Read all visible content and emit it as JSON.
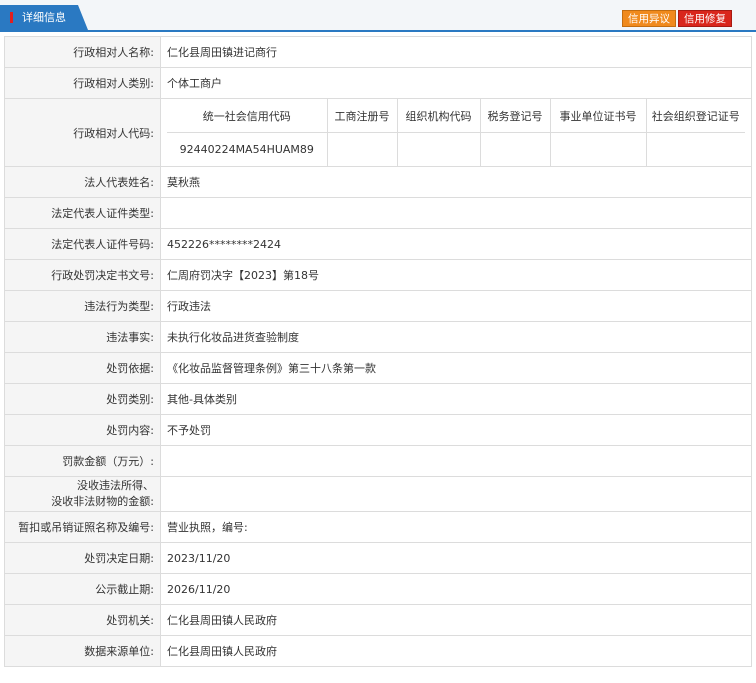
{
  "header": {
    "tab_label": "详细信息",
    "objection_button": "信用异议",
    "repair_button": "信用修复"
  },
  "fields": {
    "name": {
      "label": "行政相对人名称:",
      "value": "仁化县周田镇进记商行"
    },
    "category": {
      "label": "行政相对人类别:",
      "value": "个体工商户"
    },
    "codes_label": "行政相对人代码:",
    "legal_rep": {
      "label": "法人代表姓名:",
      "value": "莫秋燕"
    },
    "cert_type": {
      "label": "法定代表人证件类型:",
      "value": ""
    },
    "cert_no": {
      "label": "法定代表人证件号码:",
      "value": "452226********2424"
    },
    "doc_no": {
      "label": "行政处罚决定书文号:",
      "value": "仁周府罚决字【2023】第18号"
    },
    "violation_type": {
      "label": "违法行为类型:",
      "value": "行政违法"
    },
    "violation_fact": {
      "label": "违法事实:",
      "value": "未执行化妆品进货查验制度"
    },
    "basis": {
      "label": "处罚依据:",
      "value": "《化妆品监督管理条例》第三十八条第一款"
    },
    "penalty_category": {
      "label": "处罚类别:",
      "value": "其他-具体类别"
    },
    "penalty_content": {
      "label": "处罚内容:",
      "value": "不予处罚"
    },
    "fine": {
      "label": "罚款金额（万元）:",
      "value": ""
    },
    "confiscation": {
      "label_line1": "没收违法所得、",
      "label_line2": "没收非法财物的金额:",
      "value": ""
    },
    "license": {
      "label": "暂扣或吊销证照名称及编号:",
      "value": "营业执照，编号:"
    },
    "decision_date": {
      "label": "处罚决定日期:",
      "value": "2023/11/20"
    },
    "publicity_end": {
      "label": "公示截止期:",
      "value": "2026/11/20"
    },
    "authority": {
      "label": "处罚机关:",
      "value": "仁化县周田镇人民政府"
    },
    "source_unit": {
      "label": "数据来源单位:",
      "value": "仁化县周田镇人民政府"
    }
  },
  "codes": {
    "headers": [
      "统一社会信用代码",
      "工商注册号",
      "组织机构代码",
      "税务登记号",
      "事业单位证书号",
      "社会组织登记证号"
    ],
    "values": [
      "92440224MA54HUAM89",
      "",
      "",
      "",
      "",
      ""
    ]
  }
}
